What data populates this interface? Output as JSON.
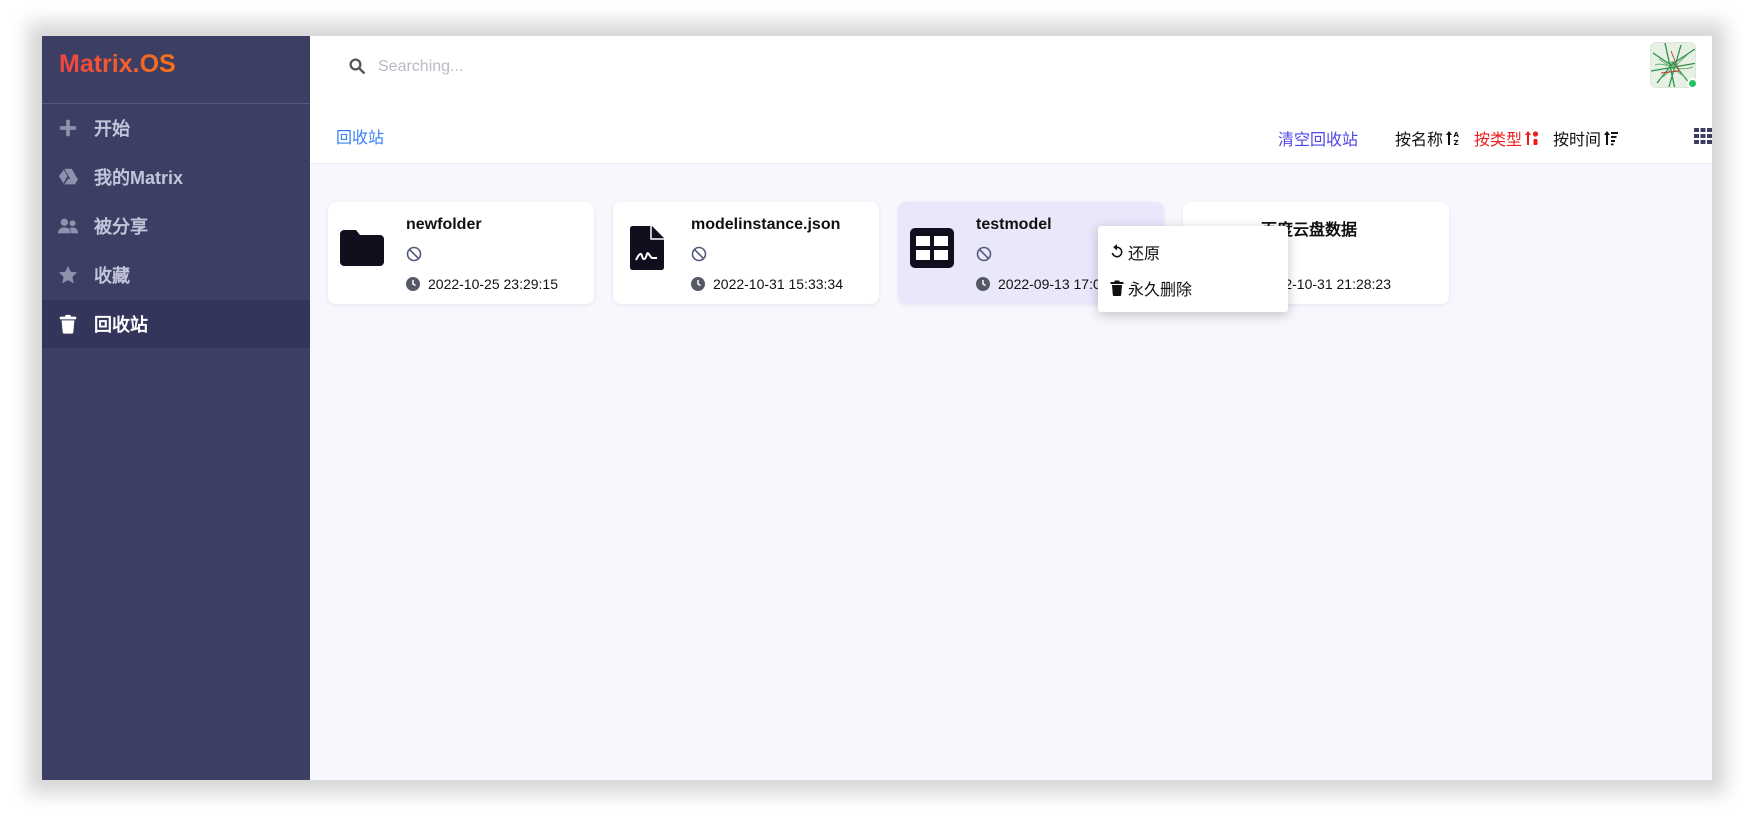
{
  "app": {
    "brand": "Matrix.OS"
  },
  "search": {
    "placeholder": "Searching..."
  },
  "sidebar": {
    "items": [
      {
        "label": "开始",
        "icon": "plus-icon"
      },
      {
        "label": "我的Matrix",
        "icon": "drive-icon"
      },
      {
        "label": "被分享",
        "icon": "users-icon"
      },
      {
        "label": "收藏",
        "icon": "star-icon"
      },
      {
        "label": "回收站",
        "icon": "trash-icon",
        "active": true
      }
    ]
  },
  "toolbar": {
    "breadcrumb": "回收站",
    "empty_trash": "清空回收站",
    "sort_name": "按名称",
    "sort_type": "按类型",
    "sort_time": "按时间",
    "active_sort_color": "#ef1d1d"
  },
  "files": [
    {
      "name": "newfolder",
      "icon": "folder-icon",
      "time": "2022-10-25 23:29:15"
    },
    {
      "name": "modelinstance.json",
      "icon": "json-file-icon",
      "time": "2022-10-31 15:33:34"
    },
    {
      "name": "testmodel",
      "icon": "table-model-icon",
      "time": "2022-09-13 17:0",
      "selected": true
    },
    {
      "name": "百度云盘数据",
      "icon": "cloud-data-icon",
      "time": "2022-10-31 21:28:23"
    }
  ],
  "context_menu": {
    "restore": "还原",
    "delete_forever": "永久删除"
  },
  "colors": {
    "sidebar_bg": "#3c3e63",
    "accent_blue": "#3b82f6",
    "brand_gradient": [
      "#ef4444",
      "#f97316"
    ],
    "online": "#22c55e"
  }
}
